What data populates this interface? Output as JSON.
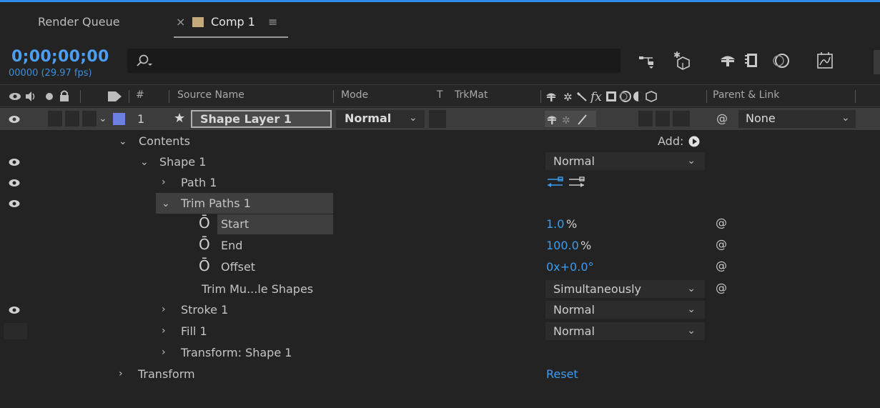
{
  "tabs": {
    "render_queue": "Render Queue",
    "close_mark": "×",
    "comp": "Comp 1",
    "menu_mark": "≡",
    "comp_color": "#c4a97a"
  },
  "timecode": {
    "value": "0;00;00;00",
    "frames": "00000 (29.97 fps)"
  },
  "search": {
    "placeholder": ""
  },
  "header": {
    "hash": "#",
    "source_name": "Source Name",
    "mode": "Mode",
    "t": "T",
    "trkmat": "TrkMat",
    "parent_link": "Parent & Link"
  },
  "layer": {
    "number": "1",
    "name": "Shape Layer 1",
    "mode": "Normal",
    "parent": "None",
    "label_color": "#6b80e0"
  },
  "contents": {
    "label": "Contents",
    "add_label": "Add:"
  },
  "shape": {
    "label": "Shape 1",
    "blend_mode": "Normal"
  },
  "path": {
    "label": "Path 1"
  },
  "trim": {
    "label": "Trim Paths 1",
    "start_label": "Start",
    "start_value": "1.0",
    "start_unit": "%",
    "end_label": "End",
    "end_value": "100.0",
    "end_unit": "%",
    "offset_label": "Offset",
    "offset_value": "0x+0.0°",
    "multi_label": "Trim Mu...le Shapes",
    "multi_value": "Simultaneously"
  },
  "stroke": {
    "label": "Stroke 1",
    "mode": "Normal"
  },
  "fill": {
    "label": "Fill 1",
    "mode": "Normal"
  },
  "transform_shape": {
    "label": "Transform: Shape 1"
  },
  "transform": {
    "label": "Transform",
    "reset": "Reset"
  }
}
